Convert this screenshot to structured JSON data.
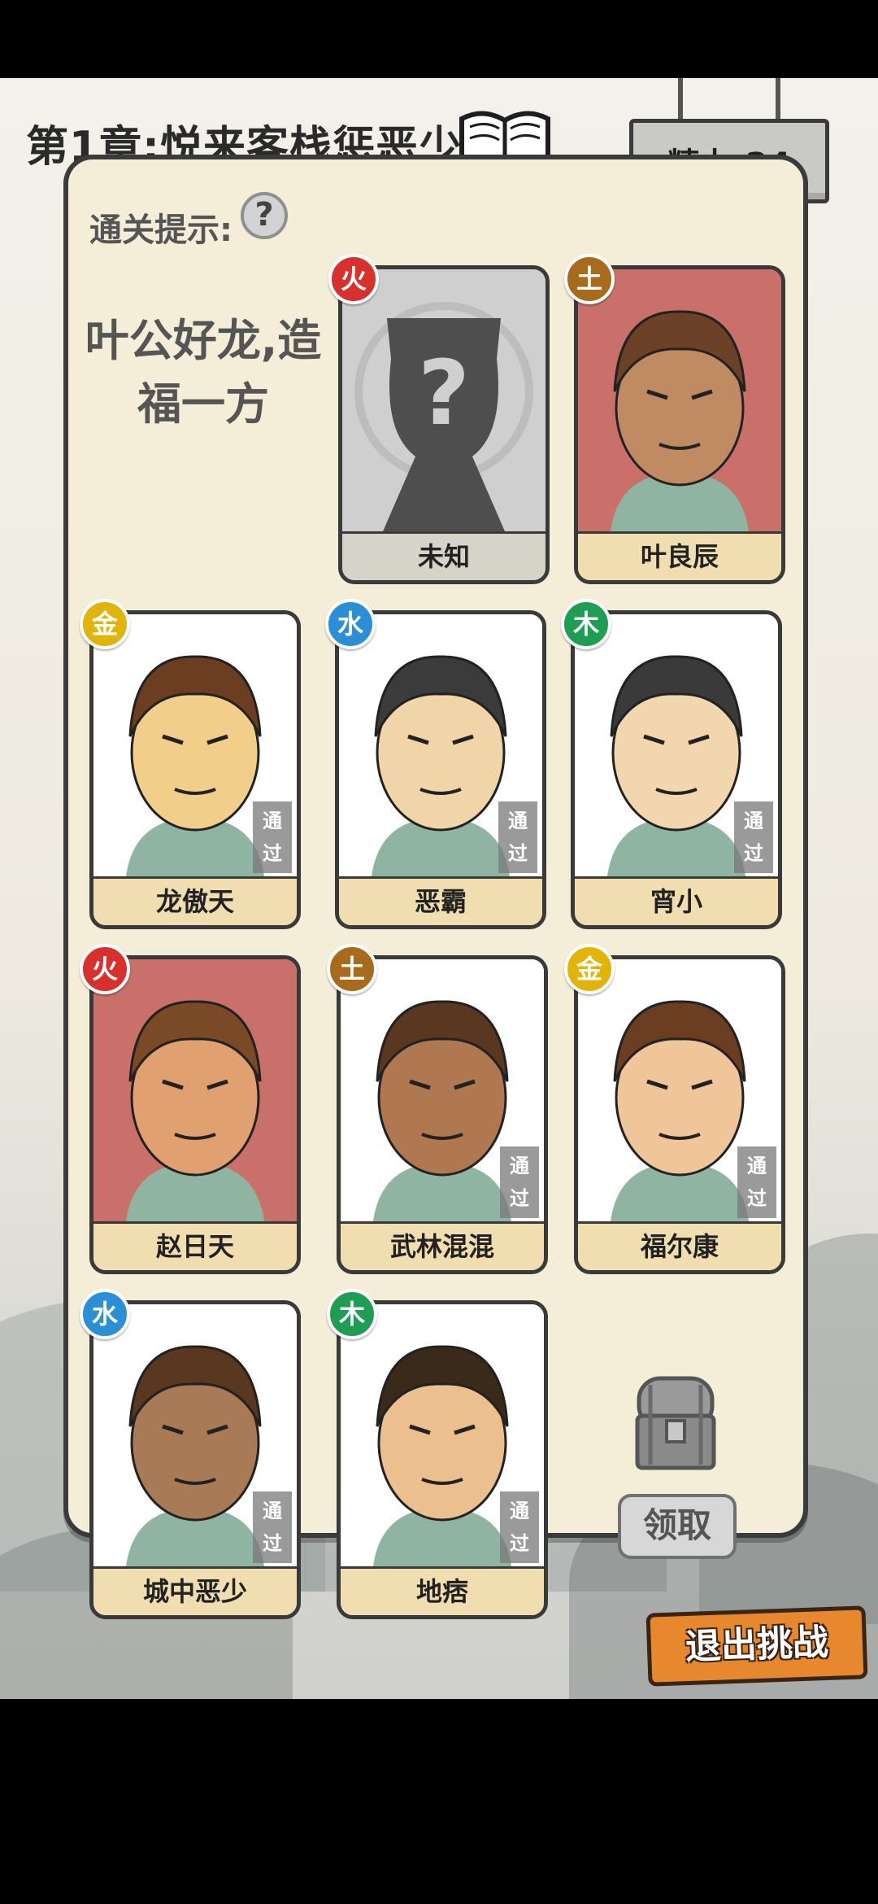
{
  "header": {
    "chapter_title": "第1章:悦来客栈惩恶少",
    "energy": "精力:24"
  },
  "hint": {
    "label": "通关提示:",
    "help": "?",
    "line1": "叶公好龙,造",
    "line2": "福一方"
  },
  "stamp_text": [
    "通",
    "过"
  ],
  "cards": [
    {
      "name": "未知",
      "element": "火",
      "cleared": false,
      "locked": true
    },
    {
      "name": "叶良辰",
      "element": "土",
      "cleared": false,
      "locked": false
    },
    {
      "name": "龙傲天",
      "element": "金",
      "cleared": true,
      "locked": false
    },
    {
      "name": "恶霸",
      "element": "水",
      "cleared": true,
      "locked": false
    },
    {
      "name": "宵小",
      "element": "木",
      "cleared": true,
      "locked": false
    },
    {
      "name": "赵日天",
      "element": "火",
      "cleared": false,
      "locked": false
    },
    {
      "name": "武林混混",
      "element": "土",
      "cleared": true,
      "locked": false
    },
    {
      "name": "福尔康",
      "element": "金",
      "cleared": true,
      "locked": false
    },
    {
      "name": "城中恶少",
      "element": "水",
      "cleared": true,
      "locked": false
    },
    {
      "name": "地痞",
      "element": "木",
      "cleared": true,
      "locked": false
    }
  ],
  "reward": {
    "claim_label": "领取"
  },
  "footer": {
    "exit_label": "退出挑战"
  },
  "colors": {
    "fire": "#d8302c",
    "earth": "#a86a1c",
    "metal": "#e2b40a",
    "water": "#2a8fd4",
    "wood": "#1f9e53"
  }
}
